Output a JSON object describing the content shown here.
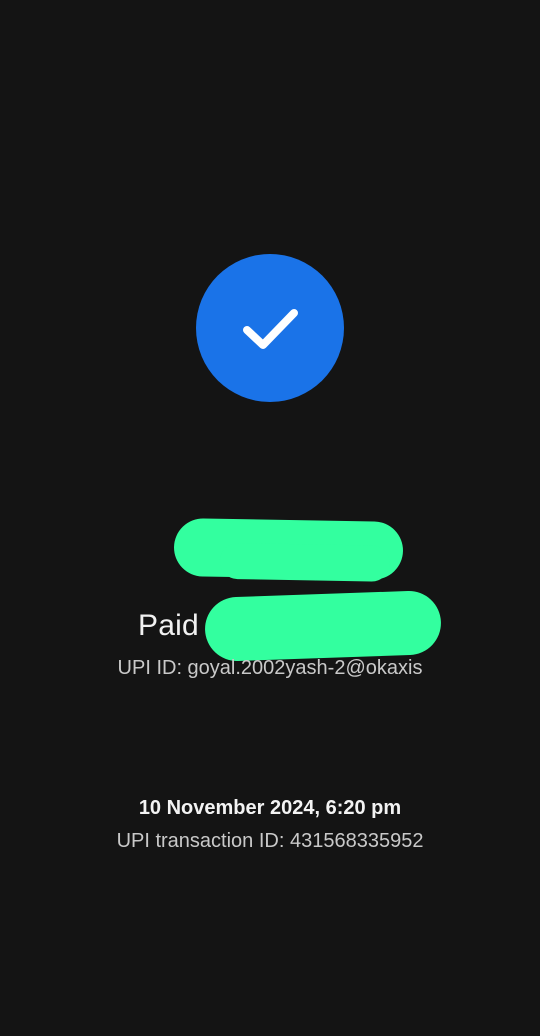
{
  "status": {
    "icon": "checkmark-icon",
    "accent_color": "#1a73e8"
  },
  "payment": {
    "paid_label": "Paid",
    "upi_id": "UPI ID: goyal.2002yash-2@okaxis"
  },
  "transaction": {
    "datetime": "10 November 2024, 6:20 pm",
    "upi_transaction_id": "UPI transaction ID: 431568335952"
  },
  "redaction_color": "#33ff9f"
}
